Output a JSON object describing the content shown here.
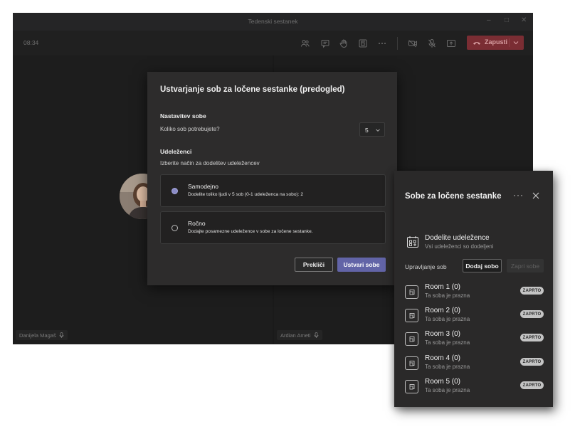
{
  "window": {
    "title": "Tedenski sestanek",
    "time": "08:34"
  },
  "toolbar": {
    "leave_label": "Zapusti"
  },
  "participants": [
    {
      "name": "Danijela Magaš"
    },
    {
      "name": "Ardian Ameti"
    }
  ],
  "dialog": {
    "title": "Ustvarjanje sob za ločene sestanke (predogled)",
    "room_setup_heading": "Nastavitev sobe",
    "room_count_question": "Koliko sob potrebujete?",
    "room_count_value": "5",
    "participants_heading": "Udeleženci",
    "participants_prompt": "Izberite način za dodelitev udeležencev",
    "options": [
      {
        "title": "Samodejno",
        "desc": "Dodelite toliko ljudi v 5 sob (0-1 udeleženca na sobo): 2",
        "selected": true
      },
      {
        "title": "Ročno",
        "desc": "Dodajte posamezne udeležence v sobe za ločene sestanke.",
        "selected": false
      }
    ],
    "cancel_label": "Prekliči",
    "create_label": "Ustvari sobe"
  },
  "panel": {
    "title": "Sobe za ločene sestanke",
    "more_label": "···",
    "assign_title": "Dodelite udeležence",
    "assign_sub": "Vsi udeleženci so dodeljeni",
    "manage_label": "Upravljanje sob",
    "add_room_label": "Dodaj sobo",
    "close_rooms_label": "Zapri sobe",
    "rooms": [
      {
        "name": "Room 1 (0)",
        "status": "Ta soba je prazna",
        "badge": "ZAPRTO"
      },
      {
        "name": "Room 2 (0)",
        "status": "Ta soba je prazna",
        "badge": "ZAPRTO"
      },
      {
        "name": "Room 3 (0)",
        "status": "Ta soba je prazna",
        "badge": "ZAPRTO"
      },
      {
        "name": "Room 4 (0)",
        "status": "Ta soba je prazna",
        "badge": "ZAPRTO"
      },
      {
        "name": "Room 5 (0)",
        "status": "Ta soba je prazna",
        "badge": "ZAPRTO"
      }
    ]
  },
  "colors": {
    "accent": "#6264a7",
    "leave": "#7a2d33",
    "panel_bg": "#2a2929",
    "dialog_bg": "#2d2c2c"
  }
}
